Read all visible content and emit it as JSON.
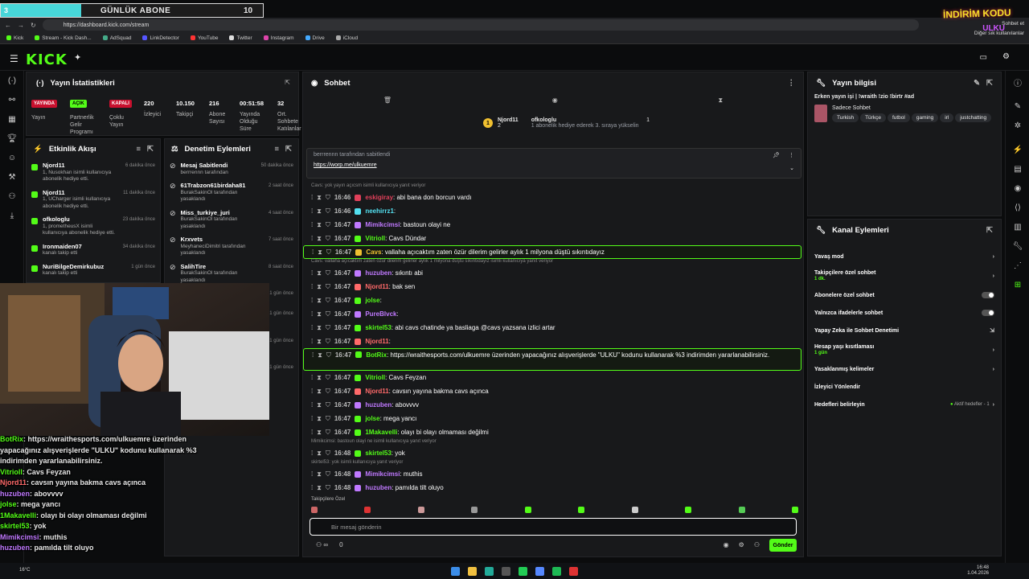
{
  "overlay_banner": {
    "left_value": "3",
    "title": "GÜNLÜK ABONE",
    "count": "10"
  },
  "promo": {
    "line1": "İNDİRİM KODU",
    "line2": "ULKU"
  },
  "browser": {
    "url": "https://dashboard.kick.com/stream",
    "right_label": "Sohbet et",
    "right_label2": "Diğer sık kullanılanlar",
    "bookmarks": [
      "Kick",
      "Stream - Kick Dash...",
      "AdSquad",
      "LinkDetector",
      "YouTube",
      "Twitter",
      "Instagram",
      "Drive",
      "iCloud"
    ]
  },
  "logo": "KICK",
  "stats": {
    "title": "Yayın İstatistikleri",
    "live": "YAYINDA",
    "open": "AÇIK",
    "closed": "KAPALI",
    "live_label": "Yayın",
    "partner_label": "Partnerlik Gelir Programı",
    "multi_label": "Çoklu Yayın",
    "viewers": "220",
    "viewers_label": "İzleyici",
    "followers": "10.150",
    "followers_label": "Takipçi",
    "subs": "216",
    "subs_label": "Abone Sayısı",
    "uptime": "00:51:58",
    "uptime_label": "Yayında Olduğu Süre",
    "avg": "32",
    "avg_label": "Ort. Sohbete Katılanlar"
  },
  "events": {
    "title": "Etkinlik Akışı",
    "items": [
      {
        "name": "Njord11",
        "desc": "1, Nusokhan isimli kullanıcıya abonelik hediye etti.",
        "time": "6 dakika önce"
      },
      {
        "name": "Njord11",
        "desc": "1, UCharger isimli kullanıcıya abonelik hediye etti.",
        "time": "11 dakika önce"
      },
      {
        "name": "ofkologlu",
        "desc": "1, prometheusX isimli kullanıcıya abonelik hediye etti.",
        "time": "23 dakika önce"
      },
      {
        "name": "Ironmaiden07",
        "desc": "kanalı takip etti",
        "time": "34 dakika önce"
      },
      {
        "name": "NuriBilgeDemirkubuz",
        "desc": "kanalı takip etti",
        "time": "1 gün önce"
      }
    ]
  },
  "mod": {
    "title": "Denetim Eylemleri",
    "items": [
      {
        "name": "Mesaj Sabitlendi",
        "desc": "berrrennn tarafından",
        "time": "50 dakika önce"
      },
      {
        "name": "61Trabzon61birdaha81",
        "desc": "BurakSakinOl tarafından yasaklandı",
        "time": "2 saat önce"
      },
      {
        "name": "Miss_turkiye_juri",
        "desc": "BurakSakinOl tarafından yasaklandı",
        "time": "4 saat önce"
      },
      {
        "name": "Krxvets",
        "desc": "MeyhaneciDimitri tarafından yasaklandı",
        "time": "7 saat önce"
      },
      {
        "name": "SalihTire",
        "desc": "BurakSakinOl tarafından yasaklandı",
        "time": "8 saat önce"
      },
      {
        "name": "usgek",
        "desc": "berrrennn tarafından yasaklandı",
        "time": "1 gün önce"
      },
      {
        "name": "Kategori",
        "desc": "UlkuEmre tarafından Just Chatting olarak değiştirildi",
        "time": "1 gün önce"
      },
      {
        "name": "Kategori",
        "desc": "berrrennn tarafından IRL olarak değiştirildi",
        "time": "1 gün önce"
      },
      {
        "name": "FPS_Rambo1",
        "desc": "BurakSakinOl tarafından yasaklandı",
        "time": "1 gün önce"
      }
    ]
  },
  "chat": {
    "title": "Sohbet",
    "top_user": "Njord11",
    "top_count": "2",
    "top_gifter": "ofkologlu",
    "top_gifter_count": "1",
    "top_gifter_note": "1 abonelik hediye ederek 3. sıraya yükselin",
    "pinned_by": "berrrennn tarafından sabitlendi",
    "pinned_link": "https://worp.me/ulkuemre",
    "messages": [
      {
        "note": "Cavs: yok yayın açıcsm isimli kullanıcıya yanıt veriyor"
      },
      {
        "time": "16:46",
        "user": "eskigiray",
        "color": "#e0405a",
        "text": ": abi bana don borcun vardı"
      },
      {
        "time": "16:46",
        "user": "neehirrz1",
        "color": "#53e0f0",
        "text": ":"
      },
      {
        "time": "16:47",
        "user": "Mimikcimsi",
        "color": "#c079ff",
        "text": ": bastoun olayi ne"
      },
      {
        "time": "16:47",
        "user": "Vitrioll",
        "color": "#53fc18",
        "text": ": Cavs Dündar"
      },
      {
        "time": "16:47",
        "user": "Cavs",
        "color": "#f0c030",
        "text": ": vallaha açıcaktım zaten özür dilerim gelirler aylık 1 milyona düştü sıkıntıdayız",
        "hl": true
      },
      {
        "note": "Cavs: vallaha açıcaktım zaten özür dilerim gelirler aylık 1 milyona düştü sıkıntıdayız isimli kullanıcıya yanıt veriyor"
      },
      {
        "time": "16:47",
        "user": "huzuben",
        "color": "#c079ff",
        "text": ": sıkıntı abi"
      },
      {
        "time": "16:47",
        "user": "Njord11",
        "color": "#ff6a6a",
        "text": ": bak sen"
      },
      {
        "time": "16:47",
        "user": "jolse",
        "color": "#53fc18",
        "text": ":"
      },
      {
        "time": "16:47",
        "user": "PureBlvck",
        "color": "#c079ff",
        "text": ":"
      },
      {
        "time": "16:47",
        "user": "skirtel53",
        "color": "#53fc18",
        "text": ": abi cavs chatinde ya basliaga @cavs yazsana izlici artar"
      },
      {
        "time": "16:47",
        "user": "Njord11",
        "color": "#ff6a6a",
        "text": ":"
      },
      {
        "time": "16:47",
        "user": "BotRix",
        "color": "#53fc18",
        "text": ": https://wraithesports.com/ulkuemre üzerinden yapacağınız alışverişlerde \"ULKU\" kodunu kullanarak %3 indirimden yararlanabilirsiniz.",
        "hl": true,
        "tall": true
      },
      {
        "time": "16:47",
        "user": "Vitrioll",
        "color": "#53fc18",
        "text": ": Cavs Feyzan"
      },
      {
        "time": "16:47",
        "user": "Njord11",
        "color": "#ff6a6a",
        "text": ": cavsın yayına bakma cavs açınca"
      },
      {
        "time": "16:47",
        "user": "huzuben",
        "color": "#c079ff",
        "text": ": abovvvv"
      },
      {
        "time": "16:47",
        "user": "jolse",
        "color": "#53fc18",
        "text": ": mega yancı"
      },
      {
        "time": "16:47",
        "user": "1Makavelli",
        "color": "#53fc18",
        "text": ": olayı bi olayı olmaması değilmi"
      },
      {
        "note": "Mimikcimsi: bastoun olayi ne isimli kullanıcıya yanıt veriyor"
      },
      {
        "time": "16:48",
        "user": "skirtel53",
        "color": "#53fc18",
        "text": ": yok"
      },
      {
        "note": "skirtel53: yok isimli kullanıcıya yanıt veriyor"
      },
      {
        "time": "16:48",
        "user": "Mimikcimsi",
        "color": "#c079ff",
        "text": ": muthis"
      },
      {
        "time": "16:48",
        "user": "huzuben",
        "color": "#c079ff",
        "text": ": pamılda tilt oluyo"
      }
    ],
    "followers_only": "Takipçilere Özel",
    "input_placeholder": "Bir mesaj gönderin",
    "send": "Gönder",
    "viewer_count": "0"
  },
  "stream_info": {
    "title": "Yayın bilgisi",
    "stream_title": "Erken yayın işi | !wraith !zio !birtr #ad",
    "category": "Sadece Sohbet",
    "tags": [
      "Turkish",
      "Türkçe",
      "futbol",
      "gaming",
      "irl",
      "justchatting"
    ]
  },
  "channel_actions": {
    "title": "Kanal Eylemleri",
    "slow": "Yavaş mod",
    "followers_only": "Takipçilere özel sohbet",
    "followers_only_sub": "1 dk.",
    "subs_only": "Abonelere özel sohbet",
    "emote_only": "Yalnızca ifadelerle sohbet",
    "ai_mod": "Yapay Zeka ile Sohbet Denetimi",
    "account_age": "Hesap yaşı kısıtlaması",
    "account_age_sub": "1 gün",
    "banned_words": "Yasaklanmış kelimeler",
    "redirect": "İzleyici Yönlendir",
    "goals": "Hedefleri belirleyin",
    "goals_status": "Aktif hedefler - 1"
  },
  "overlay_chat": [
    {
      "user": "BotRix",
      "color": "#53fc18",
      "text": ": https://wraithesports.com/ulkuemre üzerinden"
    },
    {
      "user": "",
      "color": "#fff",
      "text": "yapacağınız alışverişlerde \"ULKU\" kodunu kullanarak %3"
    },
    {
      "user": "",
      "color": "#fff",
      "text": "indirimden yararlanabilirsiniz."
    },
    {
      "user": "Vitrioll",
      "color": "#53fc18",
      "text": ": Cavs Feyzan"
    },
    {
      "user": "Njord11",
      "color": "#ff6a6a",
      "text": ": cavsın yayına bakma cavs açınca"
    },
    {
      "user": "huzuben",
      "color": "#c079ff",
      "text": ": abovvvv"
    },
    {
      "user": "jolse",
      "color": "#53fc18",
      "text": ": mega yancı"
    },
    {
      "user": "1Makavelli",
      "color": "#53fc18",
      "text": ": olayı bi olayı olmaması değilmi"
    },
    {
      "user": "skirtel53",
      "color": "#53fc18",
      "text": ": yok"
    },
    {
      "user": "Mimikcimsi",
      "color": "#c079ff",
      "text": ": muthis"
    },
    {
      "user": "huzuben",
      "color": "#c079ff",
      "text": ": pamılda tilt oluyo"
    }
  ],
  "taskbar": {
    "time": "16:48",
    "date": "1.04.2026",
    "weather": "16°C"
  }
}
